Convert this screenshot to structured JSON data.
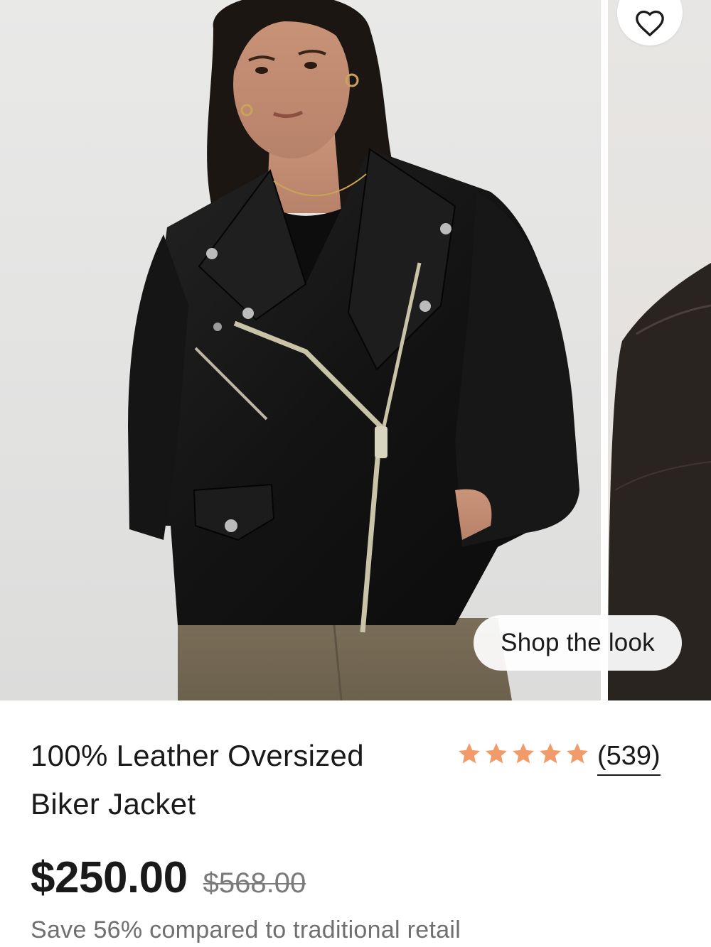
{
  "product": {
    "title_line1": "100% Leather Oversized",
    "title_line2": "Biker Jacket",
    "rating": 5,
    "review_count": "(539)",
    "price": "$250.00",
    "original_price": "$568.00",
    "savings_text": "Save 56% compared to traditional retail"
  },
  "gallery": {
    "shop_the_look_label": "Shop the look",
    "wishlist_icon": "heart-icon"
  },
  "colors": {
    "star": "#f19b6b",
    "text": "#1a1a1a",
    "muted": "#6f6f6f",
    "jacket": "#141414"
  }
}
